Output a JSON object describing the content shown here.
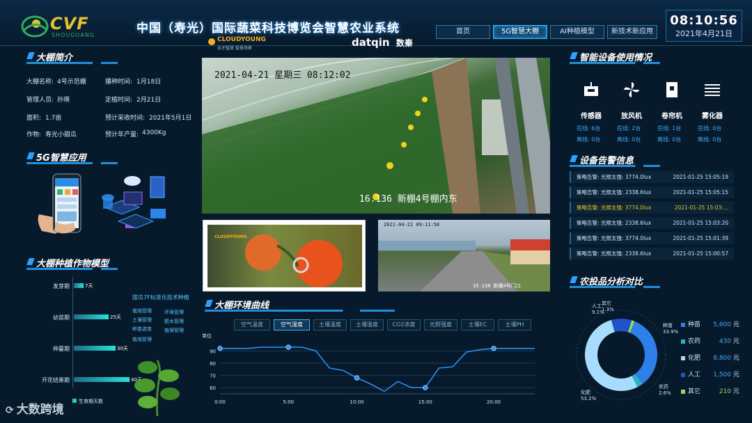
{
  "header": {
    "title": "中国（寿光）国际蔬菜科技博览会智慧农业系统",
    "logo_text": "CVF",
    "logo_sub": "SHOUGUANG",
    "nav": [
      "首页",
      "5G智慧大棚",
      "AI种植模型",
      "新技术新应用"
    ],
    "nav_active": 1,
    "time": "08:10:56",
    "date": "2021年4月21日"
  },
  "sponsors": {
    "cloudyoung": "CLOUDYOUNG",
    "cloudyoung_sub": "云才智慧 智慧场景",
    "datqin": "datqin",
    "datqin_cn": "数秦"
  },
  "greenhouse_intro": {
    "title": "大棚简介",
    "rows": [
      {
        "k1": "大棚名称:",
        "v1": "4号示范棚",
        "k2": "播种时间:",
        "v2": "1月18日"
      },
      {
        "k1": "管理人员:",
        "v1": "孙瑛",
        "k2": "定植时间:",
        "v2": "2月21日"
      },
      {
        "k1": "面积:",
        "v1": "1.7亩",
        "k2": "预计采收时间:",
        "v2": "2021年5月1日"
      },
      {
        "k1": "作物:",
        "v1": "寿光小甜瓜",
        "k2": "预计年产量:",
        "v2": "4300Kg"
      }
    ]
  },
  "app_5g": {
    "title": "5G智慧应用"
  },
  "crop_model": {
    "title": "大棚种植作物模型",
    "stages": [
      {
        "name": "发芽期",
        "days": "7天",
        "value": 7
      },
      {
        "name": "幼苗期",
        "days": "25天",
        "value": 25
      },
      {
        "name": "伸蔓期",
        "days": "30天",
        "value": 30
      },
      {
        "name": "开花结果期",
        "days": "40天",
        "value": 40
      }
    ],
    "max_days": 40,
    "standard_title": "甜瓜7F标准化技术种植",
    "tags": [
      "栽培管理",
      "环境管理",
      "土壤管理",
      "肥水管理",
      "种苗选育",
      "植保管理",
      "栽培管理"
    ],
    "legend": "生育期天数"
  },
  "camera": {
    "main_timestamp": "2021-04-21 星期三 08:12:02",
    "main_caption": "16.136 新棚4号棚内东",
    "right_timestamp": "2021-04-21 09:11:58",
    "right_caption": "16.138 新棚4号门口"
  },
  "env_curve": {
    "title": "大棚环境曲线",
    "tabs": [
      "空气温度",
      "空气湿度",
      "土壤温度",
      "土壤湿度",
      "CO2浓度",
      "光照强度",
      "土壤EC",
      "土壤PH"
    ],
    "active_tab": 1,
    "unit": "单位"
  },
  "chart_data": {
    "type": "line",
    "title": "",
    "xlabel": "",
    "ylabel": "单位",
    "x_ticks": [
      "0:00",
      "5:00",
      "10:00",
      "15:00",
      "20:00"
    ],
    "y_ticks": [
      60,
      70,
      80,
      90
    ],
    "ylim": [
      55,
      97
    ],
    "xlim": [
      0,
      23
    ],
    "series": [
      {
        "name": "空气湿度",
        "x": [
          0,
          1,
          2,
          3,
          4,
          5,
          6,
          7,
          8,
          9,
          10,
          11,
          12,
          13,
          14,
          15,
          16,
          17,
          18,
          19,
          20,
          21,
          22,
          23
        ],
        "y": [
          92,
          92,
          92,
          93,
          93,
          93,
          93,
          90,
          76,
          74,
          68,
          63,
          57,
          65,
          60,
          60,
          76,
          77,
          89,
          91,
          92,
          92,
          92,
          92
        ]
      }
    ],
    "grid": true,
    "marked_points_x": [
      0,
      5,
      10,
      15,
      20
    ]
  },
  "devices": {
    "title": "智能设备使用情况",
    "items": [
      {
        "name": "传感器",
        "icon": "sensor-icon",
        "online": "在线: 6台",
        "offline": "离线: 0台"
      },
      {
        "name": "放风机",
        "icon": "fan-icon",
        "online": "在线: 2台",
        "offline": "离线: 0台"
      },
      {
        "name": "卷帘机",
        "icon": "roller-icon",
        "online": "在线: 1台",
        "offline": "离线: 0台"
      },
      {
        "name": "雾化器",
        "icon": "atomizer-icon",
        "online": "在线: 0台",
        "offline": "离线: 0台"
      }
    ]
  },
  "alarms": {
    "title": "设备告警信息",
    "rows": [
      {
        "msg": "策略告警: 光照太强: 3774.0lux",
        "time": "2021-01-25 15:05:19",
        "highlight": false
      },
      {
        "msg": "策略告警: 光照太强: 2338.6lux",
        "time": "2021-01-25 15:05:15",
        "highlight": false
      },
      {
        "msg": "策略告警: 光照太强: 3774.0lux",
        "time": "2021-01-25 15:03:...",
        "highlight": true
      },
      {
        "msg": "策略告警: 光照太强: 2338.6lux",
        "time": "2021-01-25 15:03:20",
        "highlight": false
      },
      {
        "msg": "策略告警: 光照太强: 3774.0lux",
        "time": "2021-01-25 15:01:39",
        "highlight": false
      },
      {
        "msg": "策略告警: 光照太强: 2338.6lux",
        "time": "2021-01-25 15:00:57",
        "highlight": false
      }
    ]
  },
  "inputs": {
    "title": "农投品分析对比",
    "items": [
      {
        "name": "种苗",
        "value": "5,600",
        "unit": "元",
        "pct": "33.9%",
        "color": "#2f7fe8"
      },
      {
        "name": "农药",
        "value": "430",
        "unit": "元",
        "pct": "2.6%",
        "color": "#2ab3c9"
      },
      {
        "name": "化肥",
        "value": "8,800",
        "unit": "元",
        "pct": "53.2%",
        "color": "#a8dcff"
      },
      {
        "name": "人工",
        "value": "1,500",
        "unit": "元",
        "pct": "9.1%",
        "color": "#1f53c7"
      },
      {
        "name": "其它",
        "value": "210",
        "unit": "元",
        "pct": "1.3%",
        "color": "#9bd46b"
      }
    ]
  },
  "watermark": "大数跨境"
}
